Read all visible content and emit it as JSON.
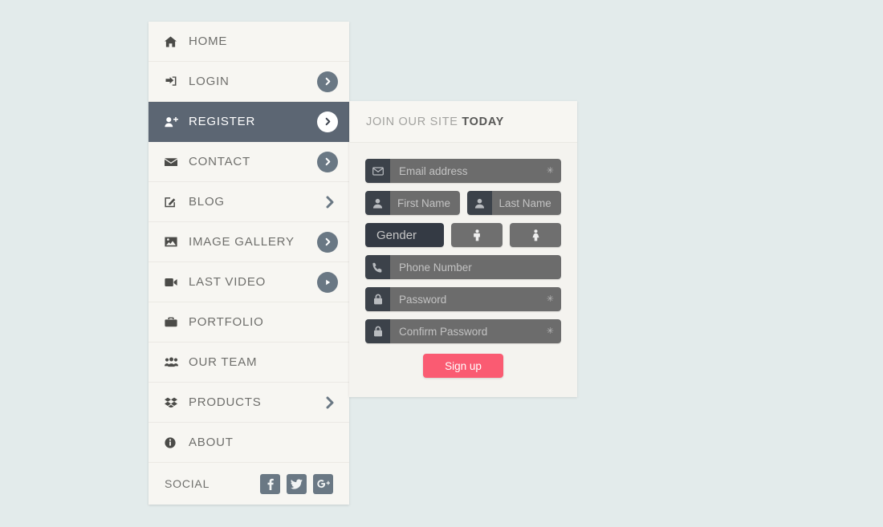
{
  "theme": {
    "page_background": "#e3ebeb",
    "panel_background": "#f7f6f2",
    "active_nav_background": "#5c6673",
    "accent_button": "#fa5b72",
    "field_input_background": "#6c6c6c",
    "field_icon_background": "#3c424a",
    "gender_label_background": "#343a44",
    "social_icon_background": "#6a7884"
  },
  "sidebar": {
    "items": [
      {
        "label": "HOME",
        "icon": "home-icon",
        "arrow": "none",
        "active": false
      },
      {
        "label": "LOGIN",
        "icon": "sign-in-icon",
        "arrow": "circle-gray",
        "active": false
      },
      {
        "label": "REGISTER",
        "icon": "user-plus-icon",
        "arrow": "circle-white",
        "active": true
      },
      {
        "label": "CONTACT",
        "icon": "envelope-icon",
        "arrow": "circle-gray",
        "active": false
      },
      {
        "label": "BLOG",
        "icon": "pencil-square-icon",
        "arrow": "chevron",
        "active": false
      },
      {
        "label": "IMAGE GALLERY",
        "icon": "picture-icon",
        "arrow": "circle-gray",
        "active": false
      },
      {
        "label": "LAST VIDEO",
        "icon": "video-icon",
        "arrow": "circle-play",
        "active": false
      },
      {
        "label": "PORTFOLIO",
        "icon": "briefcase-icon",
        "arrow": "none",
        "active": false
      },
      {
        "label": "OUR TEAM",
        "icon": "group-icon",
        "arrow": "none",
        "active": false
      },
      {
        "label": "PRODUCTS",
        "icon": "dropbox-icon",
        "arrow": "chevron",
        "active": false
      },
      {
        "label": "ABOUT",
        "icon": "info-icon",
        "arrow": "none",
        "active": false
      }
    ],
    "social": {
      "label": "SOCIAL",
      "icons": [
        {
          "name": "facebook-icon"
        },
        {
          "name": "twitter-icon"
        },
        {
          "name": "google-plus-icon"
        }
      ]
    }
  },
  "form": {
    "header": {
      "prefix": "JOIN OUR SITE",
      "emphasis": "TODAY"
    },
    "fields": {
      "email": {
        "placeholder": "Email address",
        "icon": "envelope-icon",
        "required_marker": "✳",
        "value": ""
      },
      "first": {
        "placeholder": "First Name",
        "icon": "user-icon",
        "value": ""
      },
      "last": {
        "placeholder": "Last Name",
        "icon": "user-icon",
        "value": ""
      },
      "phone": {
        "placeholder": "Phone Number",
        "icon": "phone-icon",
        "value": ""
      },
      "password": {
        "placeholder": "Password",
        "icon": "lock-icon",
        "required_marker": "✳",
        "value": ""
      },
      "confirm": {
        "placeholder": "Confirm Password",
        "icon": "lock-icon",
        "required_marker": "✳",
        "value": ""
      }
    },
    "gender": {
      "label": "Gender",
      "options": [
        {
          "name": "male-icon",
          "value": "male"
        },
        {
          "name": "female-icon",
          "value": "female"
        }
      ]
    },
    "submit_label": "Sign up"
  }
}
